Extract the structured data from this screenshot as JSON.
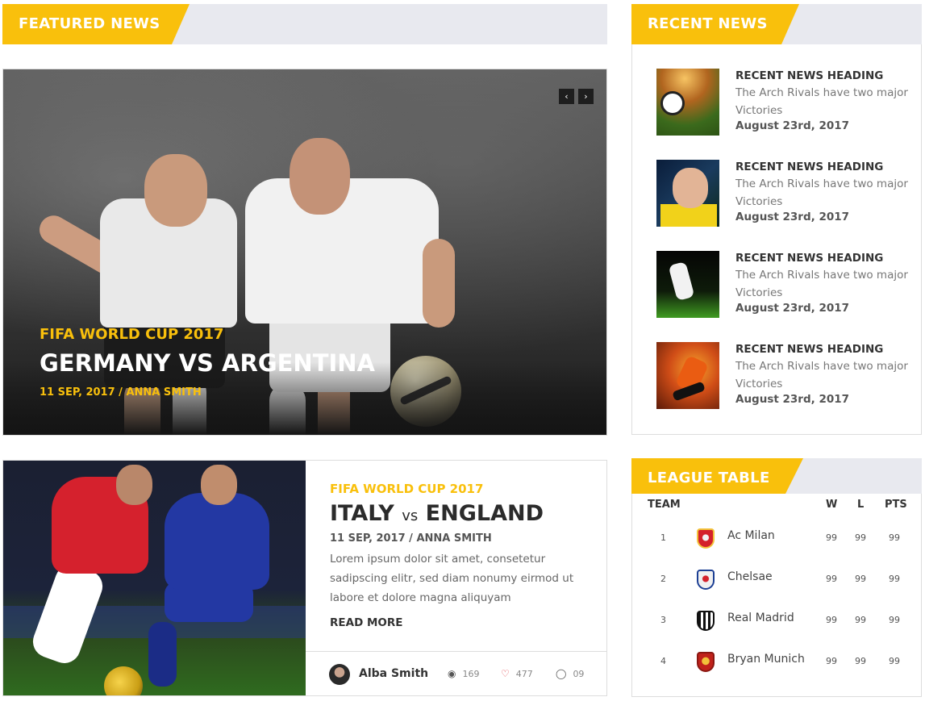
{
  "featured": {
    "header": "FEATURED NEWS",
    "slide": {
      "category": "FIFA WORLD CUP 2017",
      "title": "GERMANY VS ARGENTINA",
      "meta": "11 SEP, 2017 / ANNA SMITH"
    },
    "nav": {
      "prev_icon": "chevron-left",
      "next_icon": "chevron-right",
      "prev_glyph": "‹",
      "next_glyph": "›"
    }
  },
  "article": {
    "category": "FIFA WORLD CUP 2017",
    "title_a": "ITALY",
    "title_vs": "vs",
    "title_b": "ENGLAND",
    "meta": "11 SEP, 2017 / ANNA SMITH",
    "excerpt": "Lorem ipsum dolor sit amet, consetetur sadipscing elitr, sed diam nonumy eirmod ut labore et dolore magna aliquyam",
    "read_more": "READ MORE",
    "author": "Alba Smith",
    "views": "169",
    "likes": "477",
    "comments": "09"
  },
  "recent": {
    "header": "RECENT NEWS",
    "items": [
      {
        "heading": "RECENT NEWS HEADING",
        "desc": "The Arch Rivals have two major Victories",
        "date": "August 23rd, 2017"
      },
      {
        "heading": "RECENT NEWS HEADING",
        "desc": "The Arch Rivals have two major Victories",
        "date": "August 23rd, 2017"
      },
      {
        "heading": "RECENT NEWS HEADING",
        "desc": "The Arch Rivals have two major Victories",
        "date": "August 23rd, 2017"
      },
      {
        "heading": "RECENT NEWS HEADING",
        "desc": "The Arch Rivals have two major Victories",
        "date": "August 23rd, 2017"
      }
    ]
  },
  "league": {
    "header": "LEAGUE TABLE",
    "columns": {
      "team": "TEAM",
      "w": "W",
      "l": "L",
      "pts": "PTS"
    },
    "rows": [
      {
        "pos": "1",
        "name": "Ac Milan",
        "w": "99",
        "l": "99",
        "pts": "99"
      },
      {
        "pos": "2",
        "name": "Chelsae",
        "w": "99",
        "l": "99",
        "pts": "99"
      },
      {
        "pos": "3",
        "name": "Real Madrid",
        "w": "99",
        "l": "99",
        "pts": "99"
      },
      {
        "pos": "4",
        "name": "Bryan Munich",
        "w": "99",
        "l": "99",
        "pts": "99"
      }
    ]
  },
  "colors": {
    "accent": "#f9c00c",
    "header_bg": "#e8e9ef",
    "like": "#e2434b"
  }
}
